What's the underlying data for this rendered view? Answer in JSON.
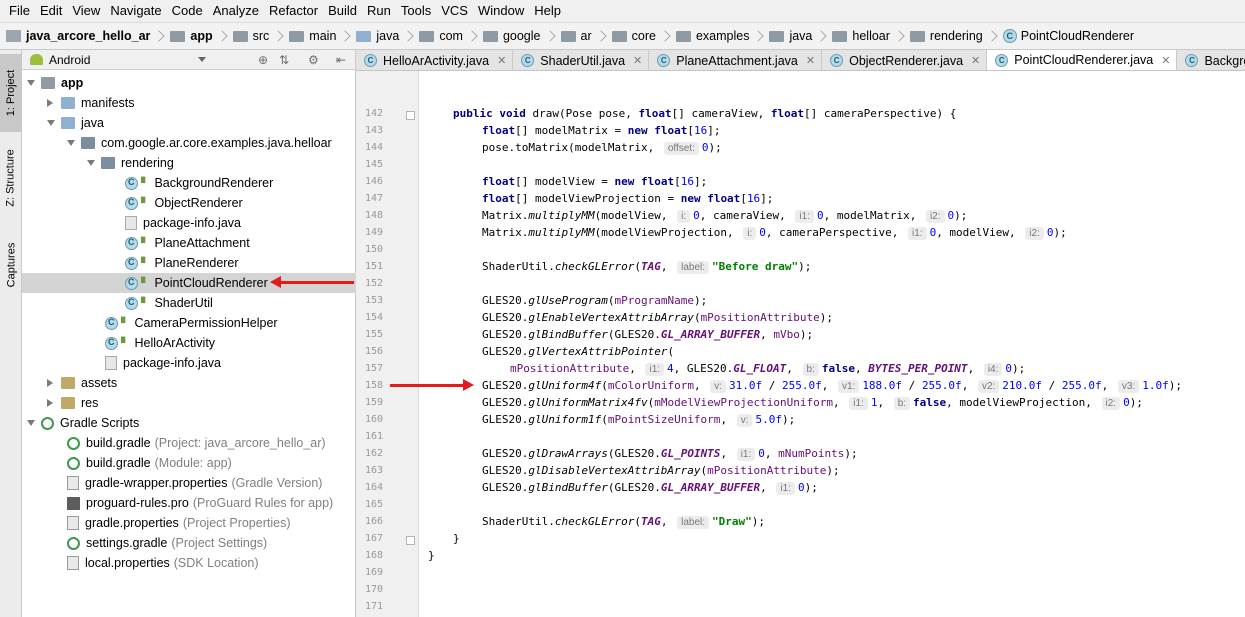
{
  "menu": [
    "File",
    "Edit",
    "View",
    "Navigate",
    "Code",
    "Analyze",
    "Refactor",
    "Build",
    "Run",
    "Tools",
    "VCS",
    "Window",
    "Help"
  ],
  "breadcrumb": [
    "java_arcore_hello_ar",
    "app",
    "src",
    "main",
    "java",
    "com",
    "google",
    "ar",
    "core",
    "examples",
    "java",
    "helloar",
    "rendering",
    "PointCloudRenderer"
  ],
  "side_tabs": [
    "1: Project",
    "Z: Structure",
    "Captures"
  ],
  "project_panel": {
    "title": "Android"
  },
  "tree": [
    {
      "label": "app",
      "extra": ""
    },
    {
      "label": "manifests",
      "extra": ""
    },
    {
      "label": "java",
      "extra": ""
    },
    {
      "label": "com.google.ar.core.examples.java.helloar",
      "extra": ""
    },
    {
      "label": "rendering",
      "extra": ""
    },
    {
      "label": "BackgroundRenderer",
      "extra": ""
    },
    {
      "label": "ObjectRenderer",
      "extra": ""
    },
    {
      "label": "package-info.java",
      "extra": ""
    },
    {
      "label": "PlaneAttachment",
      "extra": ""
    },
    {
      "label": "PlaneRenderer",
      "extra": ""
    },
    {
      "label": "PointCloudRenderer",
      "extra": ""
    },
    {
      "label": "ShaderUtil",
      "extra": ""
    },
    {
      "label": "CameraPermissionHelper",
      "extra": ""
    },
    {
      "label": "HelloArActivity",
      "extra": ""
    },
    {
      "label": "package-info.java",
      "extra": ""
    },
    {
      "label": "assets",
      "extra": ""
    },
    {
      "label": "res",
      "extra": ""
    },
    {
      "label": "Gradle Scripts",
      "extra": ""
    },
    {
      "label": "build.gradle",
      "extra": "(Project: java_arcore_hello_ar)"
    },
    {
      "label": "build.gradle",
      "extra": "(Module: app)"
    },
    {
      "label": "gradle-wrapper.properties",
      "extra": "(Gradle Version)"
    },
    {
      "label": "proguard-rules.pro",
      "extra": "(ProGuard Rules for app)"
    },
    {
      "label": "gradle.properties",
      "extra": "(Project Properties)"
    },
    {
      "label": "settings.gradle",
      "extra": "(Project Settings)"
    },
    {
      "label": "local.properties",
      "extra": "(SDK Location)"
    }
  ],
  "tabs": [
    "HelloArActivity.java",
    "ShaderUtil.java",
    "PlaneAttachment.java",
    "ObjectRenderer.java",
    "PointCloudRenderer.java",
    "BackgroundRenderer"
  ],
  "active_tab": "PointCloudRenderer.java",
  "line_numbers": [
    "142",
    "143",
    "144",
    "145",
    "146",
    "147",
    "148",
    "149",
    "150",
    "151",
    "152",
    "153",
    "154",
    "155",
    "156",
    "157",
    "158",
    "159",
    "160",
    "161",
    "162",
    "163",
    "164",
    "165",
    "166",
    "167",
    "168",
    "169",
    "170",
    "171"
  ],
  "code": {
    "l142": {
      "a": "public void",
      "b": " draw(Pose pose, ",
      "c": "float",
      "d": "[] cameraView, ",
      "e": "float",
      "f": "[] cameraPerspective) {"
    },
    "l143": {
      "a": "float",
      "b": "[] modelMatrix = ",
      "c": "new float",
      "d": "[",
      "e": "16",
      "f": "];"
    },
    "l144": {
      "a": "pose.toMatrix(modelMatrix, ",
      "h1": "offset:",
      "b": "0",
      "c": ");"
    },
    "l146": {
      "a": "float",
      "b": "[] modelView = ",
      "c": "new float",
      "d": "[",
      "e": "16",
      "f": "];"
    },
    "l147": {
      "a": "float",
      "b": "[] modelViewProjection = ",
      "c": "new float",
      "d": "[",
      "e": "16",
      "f": "];"
    },
    "l148": {
      "a": "Matrix.",
      "b": "multiplyMM",
      "c": "(modelView, ",
      "h1": "i:",
      "d": "0",
      "e": ", cameraView, ",
      "h2": "i1:",
      "f": "0",
      "g": ", modelMatrix, ",
      "h3": "i2:",
      "i": "0",
      "j": ");"
    },
    "l149": {
      "a": "Matrix.",
      "b": "multiplyMM",
      "c": "(modelViewProjection, ",
      "h1": "i:",
      "d": "0",
      "e": ", cameraPerspective, ",
      "h2": "i1:",
      "f": "0",
      "g": ", modelView, ",
      "h3": "i2:",
      "i": "0",
      "j": ");"
    },
    "l151": {
      "a": "ShaderUtil.",
      "b": "checkGLError",
      "c": "(",
      "d": "TAG",
      "e": ", ",
      "h1": "label:",
      "f": "\"Before draw\"",
      "g": ");"
    },
    "l153": {
      "a": "GLES20.",
      "b": "glUseProgram",
      "c": "(",
      "d": "mProgramName",
      "e": ");"
    },
    "l154": {
      "a": "GLES20.",
      "b": "glEnableVertexAttribArray",
      "c": "(",
      "d": "mPositionAttribute",
      "e": ");"
    },
    "l155": {
      "a": "GLES20.",
      "b": "glBindBuffer",
      "c": "(GLES20.",
      "d": "GL_ARRAY_BUFFER",
      "e": ", ",
      "f": "mVbo",
      "g": ");"
    },
    "l156": {
      "a": "GLES20.",
      "b": "glVertexAttribPointer",
      "c": "("
    },
    "l157": {
      "a": "mPositionAttribute",
      "b": ", ",
      "h1": "i1:",
      "c": "4",
      "d": ", GLES20.",
      "e": "GL_FLOAT",
      "f": ", ",
      "h2": "b:",
      "g": "false",
      "i": ", ",
      "j": "BYTES_PER_POINT",
      "k": ", ",
      "h3": "i4:",
      "l": "0",
      "m": ");"
    },
    "l158": {
      "a": "GLES20.",
      "b": "glUniform4f",
      "c": "(",
      "d": "mColorUniform",
      "e": ", ",
      "h1": "v:",
      "f": "31.0f",
      "g": " / ",
      "i": "255.0f",
      "j": ", ",
      "h2": "v1:",
      "k": "188.0f",
      "l": " / ",
      "m": "255.0f",
      "n": ", ",
      "h3": "v2:",
      "o": "210.0f",
      "p": " / ",
      "q": "255.0f",
      "r": ", ",
      "h4": "v3:",
      "s": "1.0f",
      "t": ");"
    },
    "l159": {
      "a": "GLES20.",
      "b": "glUniformMatrix4fv",
      "c": "(",
      "d": "mModelViewProjectionUniform",
      "e": ", ",
      "h1": "i1:",
      "f": "1",
      "g": ", ",
      "h2": "b:",
      "i": "false",
      "j": ", modelViewProjection, ",
      "h3": "i2:",
      "k": "0",
      "l": ");"
    },
    "l160": {
      "a": "GLES20.",
      "b": "glUniform1f",
      "c": "(",
      "d": "mPointSizeUniform",
      "e": ", ",
      "h1": "v:",
      "f": "5.0f",
      "g": ");"
    },
    "l162": {
      "a": "GLES20.",
      "b": "glDrawArrays",
      "c": "(GLES20.",
      "d": "GL_POINTS",
      "e": ", ",
      "h1": "i1:",
      "f": "0",
      "g": ", ",
      "i": "mNumPoints",
      "j": ");"
    },
    "l163": {
      "a": "GLES20.",
      "b": "glDisableVertexAttribArray",
      "c": "(",
      "d": "mPositionAttribute",
      "e": ");"
    },
    "l164": {
      "a": "GLES20.",
      "b": "glBindBuffer",
      "c": "(GLES20.",
      "d": "GL_ARRAY_BUFFER",
      "e": ", ",
      "h1": "i1:",
      "f": "0",
      "g": ");"
    },
    "l166": {
      "a": "ShaderUtil.",
      "b": "checkGLError",
      "c": "(",
      "d": "TAG",
      "e": ", ",
      "h1": "label:",
      "f": "\"Draw\"",
      "g": ");"
    },
    "l167": {
      "a": "}"
    },
    "l168": {
      "a": "}"
    }
  },
  "colors": {
    "accent_red": "#e21c1c",
    "keyword": "#000080",
    "number": "#0000ff",
    "string": "#008000",
    "field": "#660e7a"
  }
}
